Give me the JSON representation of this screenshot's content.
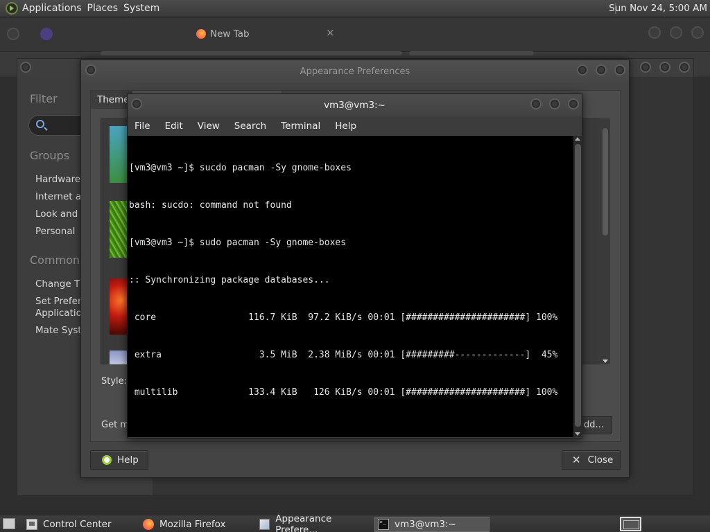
{
  "top_panel": {
    "menus": [
      "Applications",
      "Places",
      "System"
    ],
    "clock": "Sun Nov 24,  5:00 AM"
  },
  "firefox": {
    "tab_title": "New Tab",
    "tab_close": "×"
  },
  "control_center": {
    "filter_heading": "Filter",
    "groups_heading": "Groups",
    "groups": [
      "Hardware",
      "Internet an",
      "Look and F",
      "Personal"
    ],
    "common_heading": "Common T",
    "common_tasks": [
      "Change Th",
      "Set Preferre",
      "Application",
      "Mate Syster"
    ]
  },
  "appearance": {
    "title": "Appearance Preferences",
    "tab_theme": "Theme",
    "style_label": "Style:",
    "get_more_label": "Get m",
    "add_button": "dd...",
    "help_button": "Help",
    "close_button": "Close",
    "close_glyph": "✕"
  },
  "terminal": {
    "title": "vm3@vm3:~",
    "menus": [
      "File",
      "Edit",
      "View",
      "Search",
      "Terminal",
      "Help"
    ],
    "lines": [
      "[vm3@vm3 ~]$ sucdo pacman -Sy gnome-boxes",
      "bash: sucdo: command not found",
      "[vm3@vm3 ~]$ sudo pacman -Sy gnome-boxes",
      ":: Synchronizing package databases...",
      " core                 116.7 KiB  97.2 KiB/s 00:01 [######################] 100%",
      " extra                  3.5 MiB  2.38 MiB/s 00:01 [#########-------------]  45%",
      " multilib             133.4 KiB   126 KiB/s 00:01 [######################] 100%"
    ]
  },
  "bottom_panel": {
    "tasks": [
      "Control Center",
      "Mozilla Firefox",
      "Appearance Prefere...",
      "vm3@vm3:~"
    ]
  },
  "colors": {
    "terminal_bg": "#000000",
    "panel_bg": "#3a3a3a",
    "help_accent": "#9acd32"
  }
}
